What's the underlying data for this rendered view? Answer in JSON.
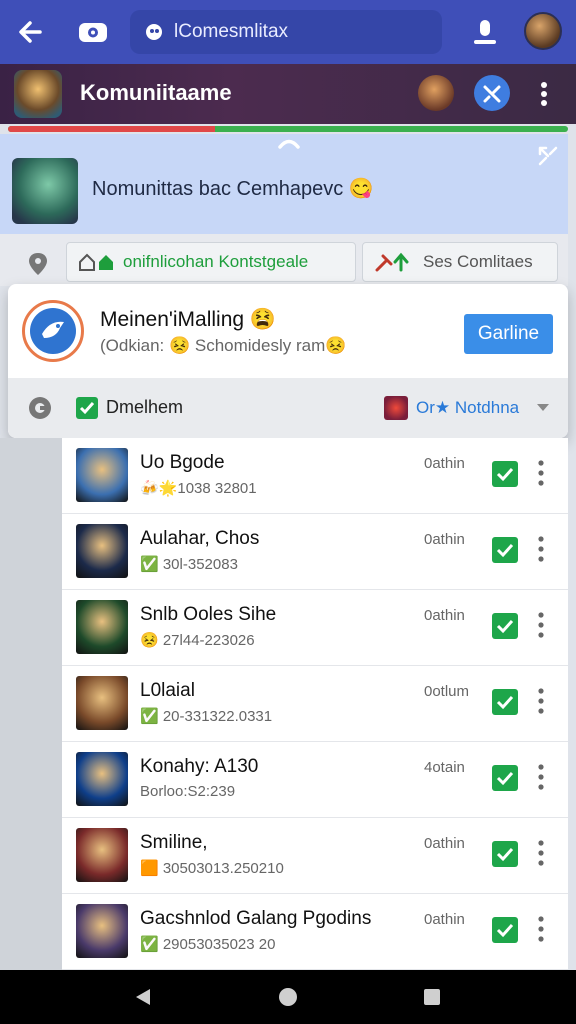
{
  "topbar": {
    "search_text": "lComesmlitax"
  },
  "community": {
    "title": "Komuniitaame"
  },
  "progress": {
    "fraction": 0.37
  },
  "banner": {
    "text": "Nomunittas bac Cemhapevc 😋"
  },
  "tabs": [
    {
      "label": "onifnlicohan Kontstgeale"
    },
    {
      "label": "Ses Comlitaes"
    }
  ],
  "card": {
    "name": "Meinen'iMalling 😫",
    "sub": "(Odkian: 😣 Schomidesly ram😣",
    "button": "Garline",
    "filter_label": "Dmelhem",
    "sort_label": "Or★ Notdhna"
  },
  "rows": [
    {
      "name": "Uo Bgode",
      "sub": "🍻🌟1038 32801",
      "status": "0athin",
      "thumb": "#3b6fb0"
    },
    {
      "name": "Aulahar, Chos",
      "sub": "✅ 30l-352083",
      "status": "0athin",
      "thumb": "#1c2a4a"
    },
    {
      "name": "Snlb Ooles Sihe",
      "sub": "😣 27l44-223026",
      "status": "0athin",
      "thumb": "#1e4a2a"
    },
    {
      "name": "L0laial",
      "sub": "✅ 20-331322.0331",
      "status": "0otlum",
      "thumb": "#7a4a2a"
    },
    {
      "name": "Konahy: A130",
      "sub": "Borloo:S2:239",
      "status": "4otain",
      "thumb": "#0f3f8a"
    },
    {
      "name": "Smiline,",
      "sub": "🟧 30503013.250210",
      "status": "0athin",
      "thumb": "#7a2a2a"
    },
    {
      "name": "Gacshnlod Galang Pgodins",
      "sub": "✅ 29053035023 20",
      "status": "0athin",
      "thumb": "#4a3a6a"
    }
  ]
}
